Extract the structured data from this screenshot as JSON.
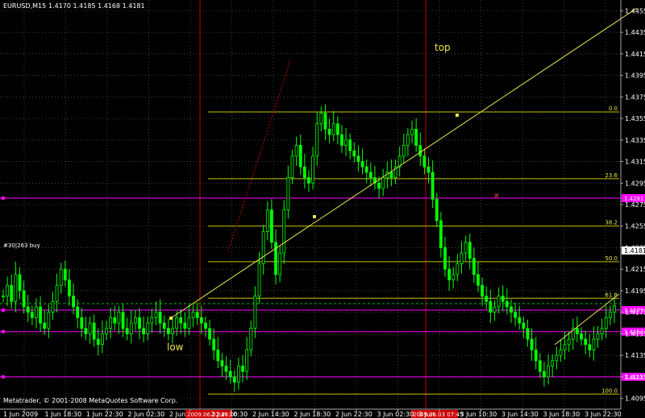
{
  "header": {
    "symbol": "EURUSD,M15",
    "ohlc": "1.4170 1.4185 1.4168 1.4181"
  },
  "footer": {
    "copyright": "Metatrader, © 2001-2008 MetaQuotes Software Corp."
  },
  "annotations": {
    "top": "top",
    "low": "low",
    "line_label": "#30|263 buy"
  },
  "colors": {
    "background": "#000000",
    "candle": "#00ff00",
    "fib": "#c8c400",
    "trend": "#e8e44a",
    "magenta": "#ff00ff",
    "vline": "#c00000",
    "grid": "#6b6b6b"
  },
  "chart_data": {
    "type": "candlestick",
    "symbol": "EURUSD",
    "timeframe": "M15",
    "ylim": [
      1.4085,
      1.4465
    ],
    "y_ticks": [
      "1.4455",
      "1.4435",
      "1.4415",
      "1.4395",
      "1.4375",
      "1.4355",
      "1.4335",
      "1.4315",
      "1.4295",
      "1.4275",
      "1.4255",
      "1.4235",
      "1.4215",
      "1.4195",
      "1.4175",
      "1.4155",
      "1.4135",
      "1.4115",
      "1.4095"
    ],
    "x_ticks": [
      "1 Jun 2009",
      "1 Jun 18:30",
      "1 Jun 22:30",
      "2 Jun 02:30",
      "2 Jun",
      "2 Jun 10:30",
      "2 Jun 14:30",
      "2 Jun 18:30",
      "2 Jun 22:30",
      "3 Jun 02:30",
      "3 Jun",
      "3 Jun 10:30",
      "3 Jun 14:30",
      "3 Jun 18:30",
      "3 Jun 22:30"
    ],
    "fib_levels": [
      {
        "label": "0.0",
        "price": 1.4361
      },
      {
        "label": "23.6",
        "price": 1.4299
      },
      {
        "label": "38.2",
        "price": 1.4255
      },
      {
        "label": "50.0",
        "price": 1.4222
      },
      {
        "label": "61.8",
        "price": 1.4188
      },
      {
        "label": "100.0",
        "price": 1.4099
      }
    ],
    "horizontal_lines": [
      {
        "label": "1.4281",
        "price": 1.4281
      },
      {
        "label": "1.4177",
        "price": 1.4177
      },
      {
        "label": "1.4157",
        "price": 1.4157
      },
      {
        "label": "1.4115",
        "price": 1.4115
      }
    ],
    "current_price": "1.4181",
    "vertical_lines": [
      "2009.06.02 10:00",
      "2009.06.03 07:45"
    ],
    "closes": [
      1.419,
      1.42,
      1.4185,
      1.421,
      1.4195,
      1.418,
      1.4175,
      1.417,
      1.418,
      1.4165,
      1.416,
      1.4175,
      1.4185,
      1.42,
      1.4215,
      1.4205,
      1.419,
      1.418,
      1.417,
      1.416,
      1.4155,
      1.4165,
      1.415,
      1.4145,
      1.4155,
      1.416,
      1.417,
      1.4165,
      1.4175,
      1.416,
      1.4155,
      1.4165,
      1.417,
      1.416,
      1.4155,
      1.4165,
      1.417,
      1.4175,
      1.4165,
      1.416,
      1.4155,
      1.416,
      1.417,
      1.4165,
      1.416,
      1.417,
      1.4175,
      1.417,
      1.4165,
      1.416,
      1.415,
      1.414,
      1.413,
      1.4125,
      1.412,
      1.4115,
      1.411,
      1.4125,
      1.412,
      1.414,
      1.416,
      1.419,
      1.422,
      1.425,
      1.427,
      1.424,
      1.421,
      1.423,
      1.427,
      1.43,
      1.432,
      1.433,
      1.431,
      1.43,
      1.4295,
      1.432,
      1.435,
      1.436,
      1.4345,
      1.434,
      1.435,
      1.434,
      1.433,
      1.4335,
      1.4325,
      1.432,
      1.4315,
      1.431,
      1.4305,
      1.43,
      1.4295,
      1.429,
      1.43,
      1.4305,
      1.43,
      1.431,
      1.432,
      1.433,
      1.434,
      1.4345,
      1.433,
      1.432,
      1.431,
      1.4305,
      1.428,
      1.426,
      1.4235,
      1.4215,
      1.4205,
      1.421,
      1.422,
      1.423,
      1.424,
      1.4225,
      1.421,
      1.42,
      1.419,
      1.4185,
      1.4175,
      1.418,
      1.419,
      1.4185,
      1.418,
      1.4175,
      1.417,
      1.4165,
      1.416,
      1.415,
      1.414,
      1.413,
      1.412,
      1.4115,
      1.4125,
      1.413,
      1.4135,
      1.414,
      1.4145,
      1.415,
      1.416,
      1.4155,
      1.415,
      1.4145,
      1.414,
      1.415,
      1.4155,
      1.416,
      1.417,
      1.4175,
      1.4181
    ]
  }
}
